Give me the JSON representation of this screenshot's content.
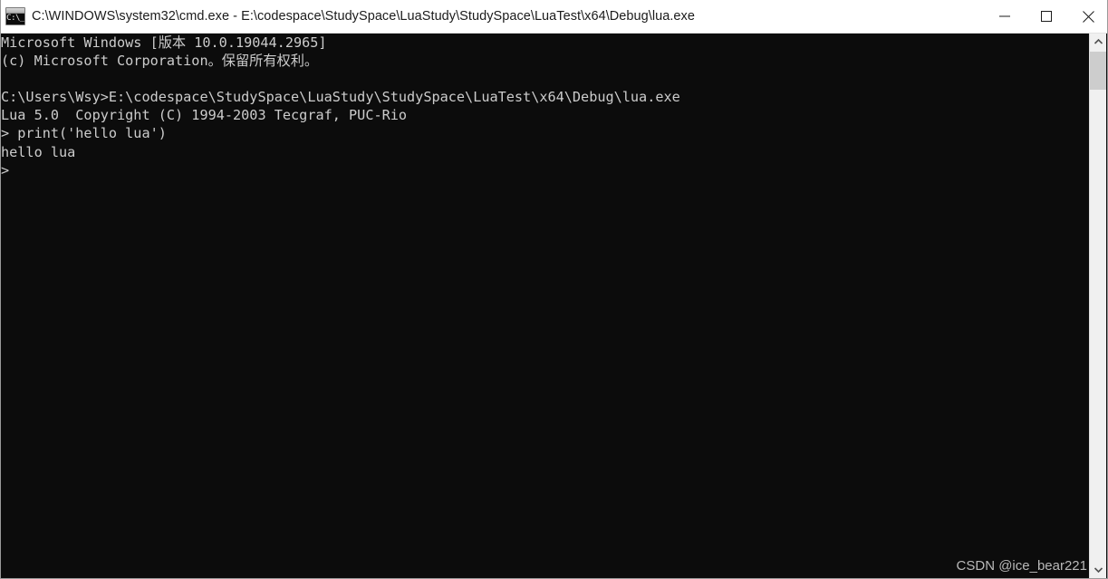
{
  "window": {
    "title": "C:\\WINDOWS\\system32\\cmd.exe - E:\\codespace\\StudySpace\\LuaStudy\\StudySpace\\LuaTest\\x64\\Debug\\lua.exe",
    "icon": "cmd-icon",
    "background_color": "#0c0c0c",
    "titlebar_color": "#ffffff",
    "text_color": "#cccccc"
  },
  "controls": {
    "minimize_label": "Minimize",
    "maximize_label": "Maximize",
    "close_label": "Close"
  },
  "scrollbar": {
    "up_arrow": "scroll-up-arrow",
    "down_arrow": "scroll-down-arrow",
    "thumb": "scrollbar-thumb"
  },
  "console": {
    "lines": [
      "Microsoft Windows [版本 10.0.19044.2965]",
      "(c) Microsoft Corporation。保留所有权利。",
      "",
      "C:\\Users\\Wsy>E:\\codespace\\StudySpace\\LuaStudy\\StudySpace\\LuaTest\\x64\\Debug\\lua.exe",
      "Lua 5.0  Copyright (C) 1994-2003 Tecgraf, PUC-Rio",
      "> print('hello lua')",
      "hello lua",
      ">"
    ],
    "full_text": "Microsoft Windows [版本 10.0.19044.2965]\n(c) Microsoft Corporation。保留所有权利。\n\nC:\\Users\\Wsy>E:\\codespace\\StudySpace\\LuaStudy\\StudySpace\\LuaTest\\x64\\Debug\\lua.exe\nLua 5.0  Copyright (C) 1994-2003 Tecgraf, PUC-Rio\n> print('hello lua')\nhello lua\n>"
  },
  "watermark": {
    "text": "CSDN @ice_bear221"
  }
}
